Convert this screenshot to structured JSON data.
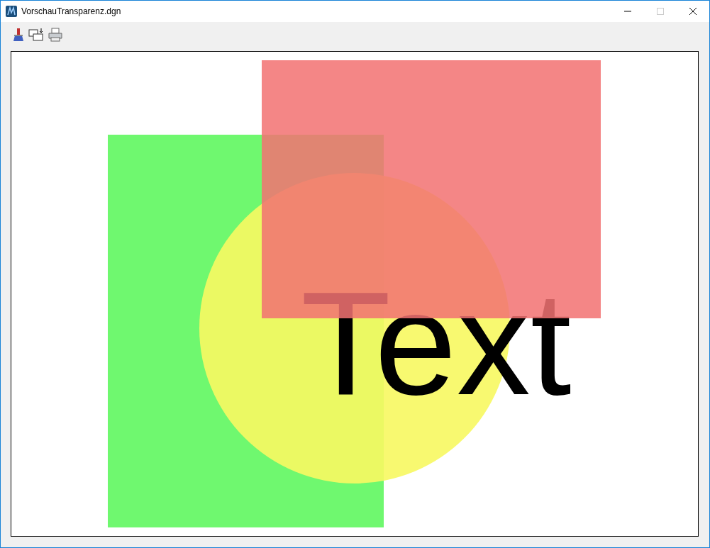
{
  "window": {
    "title": "VorschauTransparenz.dgn",
    "maximize_disabled": true
  },
  "drawing": {
    "text": "Text"
  }
}
